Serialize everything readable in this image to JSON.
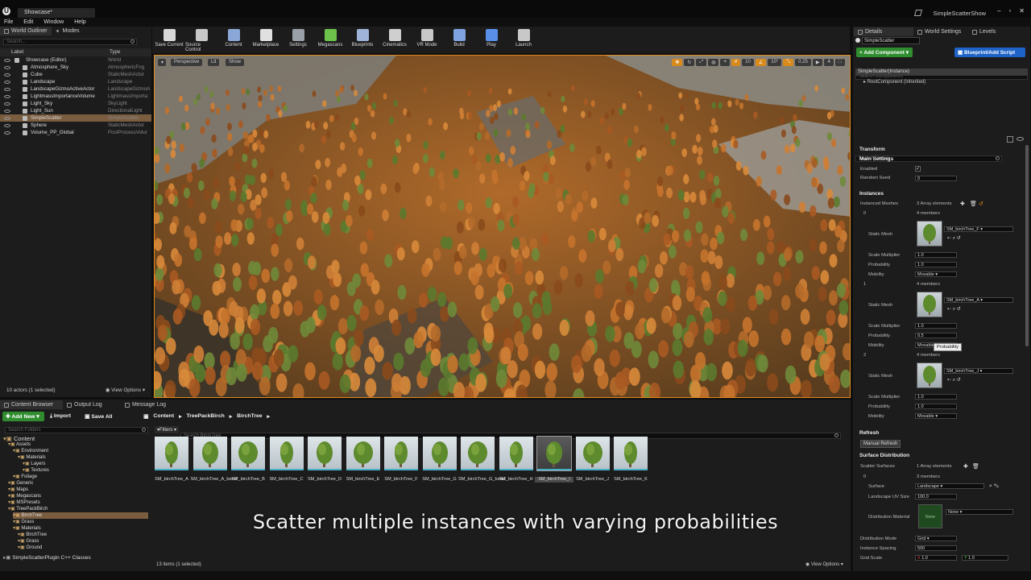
{
  "window": {
    "doc_tab": "Showcase*",
    "project_name": "SimpleScatterShow",
    "logo": "U"
  },
  "menu": [
    "File",
    "Edit",
    "Window",
    "Help"
  ],
  "outliner": {
    "tabs": [
      "World Outliner",
      "Modes"
    ],
    "search_placeholder": "Search...",
    "col_label": "Label",
    "col_type": "Type",
    "rows": [
      {
        "label": "Showcase (Editor)",
        "type": "World",
        "selected": false
      },
      {
        "label": "Atmosphere_Sky",
        "type": "AtmosphericFog",
        "selected": false
      },
      {
        "label": "Cube",
        "type": "StaticMeshActor",
        "selected": false
      },
      {
        "label": "Landscape",
        "type": "Landscape",
        "selected": false
      },
      {
        "label": "LandscapeGizmoActiveActor",
        "type": "LandscapeGizmoA",
        "selected": false
      },
      {
        "label": "LightmassImportanceVolume",
        "type": "LightmassImporta",
        "selected": false
      },
      {
        "label": "Light_Sky",
        "type": "SkyLight",
        "selected": false
      },
      {
        "label": "Light_Sun",
        "type": "DirectionalLight",
        "selected": false
      },
      {
        "label": "SimpleScatter",
        "type": "SimpleScatter",
        "selected": true
      },
      {
        "label": "Sphere",
        "type": "StaticMeshActor",
        "selected": false
      },
      {
        "label": "Volume_PP_Global",
        "type": "PostProcessVolur",
        "selected": false
      }
    ],
    "footer_count": "10 actors (1 selected)",
    "view_options": "View Options"
  },
  "toolbar": [
    {
      "label": "Save Current",
      "color": "#d8d8d8"
    },
    {
      "label": "Source Control",
      "color": "#c8c8c8"
    },
    {
      "label": "Content",
      "color": "#8aa7d8"
    },
    {
      "label": "Marketplace",
      "color": "#e0e0e0"
    },
    {
      "label": "Settings",
      "color": "#9aa0a8"
    },
    {
      "label": "Megascans",
      "color": "#6cc24a"
    },
    {
      "label": "Blueprints",
      "color": "#9fb4d8"
    },
    {
      "label": "Cinematics",
      "color": "#cfcfcf"
    },
    {
      "label": "VR Mode",
      "color": "#c8c8c8"
    },
    {
      "label": "Build",
      "color": "#7fa2e0"
    },
    {
      "label": "Play",
      "color": "#5a8fe8"
    },
    {
      "label": "Launch",
      "color": "#c8c8c8"
    }
  ],
  "viewport": {
    "perspective": "Perspective",
    "lit": "Lit",
    "show": "Show",
    "grid_value": "10",
    "angle_value": "10°",
    "scale_value": "0.25",
    "cam_speed": "4"
  },
  "content_browser": {
    "tabs": [
      "Content Browser",
      "Output Log",
      "Message Log"
    ],
    "add_new": "Add New",
    "import": "Import",
    "save_all": "Save All",
    "breadcrumb": [
      "Content",
      "TreePackBirch",
      "BirchTree"
    ],
    "search_folders": "Search Folders",
    "filters": "Filters",
    "search_assets": "Search BirchTree",
    "folders": [
      {
        "label": "Content",
        "depth": 0
      },
      {
        "label": "Assets",
        "depth": 1
      },
      {
        "label": "Environment",
        "depth": 2
      },
      {
        "label": "Materials",
        "depth": 3
      },
      {
        "label": "Layers",
        "depth": 4
      },
      {
        "label": "Textures",
        "depth": 4
      },
      {
        "label": "Foliage",
        "depth": 2
      },
      {
        "label": "Generic",
        "depth": 1
      },
      {
        "label": "Maps",
        "depth": 1
      },
      {
        "label": "Megascans",
        "depth": 1
      },
      {
        "label": "MSPresets",
        "depth": 1
      },
      {
        "label": "TreePackBirch",
        "depth": 1
      },
      {
        "label": "BirchTree",
        "depth": 2
      },
      {
        "label": "Grass",
        "depth": 2
      },
      {
        "label": "Materials",
        "depth": 2
      },
      {
        "label": "BirchTree",
        "depth": 3
      },
      {
        "label": "Grass",
        "depth": 3
      },
      {
        "label": "Ground",
        "depth": 3
      }
    ],
    "cpp_classes": "SimpleScatterPlugin C++ Classes",
    "assets": [
      "SM_birchTree_A",
      "SM_birchTree_A_bend",
      "SM_birchTree_B",
      "SM_birchTree_C",
      "SM_birchTree_D",
      "SM_birchTree_E",
      "SM_birchTree_F",
      "SM_birchTree_G",
      "SM_birchTree_G_bend",
      "SM_birchTree_H",
      "SM_birchTree_I",
      "SM_birchTree_J",
      "SM_birchTree_K"
    ],
    "footer_count": "13 items (1 selected)",
    "view_options": "View Options"
  },
  "details": {
    "tabs": [
      "Details",
      "World Settings",
      "Levels"
    ],
    "actor_name": "SimpleScatter",
    "add_component": "+ Add Component",
    "blueprint_script": "Blueprint/Add Script",
    "search_components": "Search Components",
    "instance_label": "SimpleScatter(Instance)",
    "root_component": "RootComponent (Inherited)",
    "search_details": "Search Details",
    "sections": {
      "transform": "Transform",
      "main": "Main Settings",
      "instances": "Instances",
      "refresh": "Refresh",
      "surface": "Surface Distribution"
    },
    "enabled_label": "Enabled",
    "random_seed_label": "Random Seed",
    "random_seed": "0",
    "instanced_meshes_label": "Instanced Meshes",
    "array_elements": "3 Array elements",
    "members": "4 members",
    "static_mesh_label": "Static Mesh",
    "scale_mult_label": "Scale Multiplier",
    "probability_label": "Probability",
    "mobility_label": "Mobility",
    "mesh_items": [
      {
        "index": "0",
        "mesh": "SM_birchTree_F",
        "scale": "1.0",
        "prob": "1.0",
        "mobility": "Movable"
      },
      {
        "index": "1",
        "mesh": "SM_birchTree_A",
        "scale": "1.0",
        "prob": "0.5",
        "mobility": "Movable"
      },
      {
        "index": "2",
        "mesh": "SM_birchTree_J",
        "scale": "1.0",
        "prob": "1.0",
        "mobility": "Movable"
      }
    ],
    "tooltip": "Probability",
    "manual_refresh": "Manual Refresh",
    "scatter_surfaces_label": "Scatter Surfaces",
    "one_array": "1 Array elements",
    "three_members": "3 members",
    "surface_label": "Surface",
    "surface_value": "Landscape",
    "uv_size_label": "Landscape UV Size",
    "uv_size": "100.0",
    "dist_material_label": "Distribution Material",
    "dist_material": "None",
    "dist_mode_label": "Distribution Mode",
    "dist_mode": "Grid",
    "inst_spacing_label": "Instance Spacing",
    "inst_spacing": "500",
    "grid_scale_label": "Grid Scale",
    "grid_x": "1.0",
    "grid_y": "1.0",
    "thumb_none": "None",
    "axis_x": "X",
    "axis_y": "Y",
    "index_0": "0"
  },
  "subtitle": "Scatter multiple instances with varying probabilities"
}
